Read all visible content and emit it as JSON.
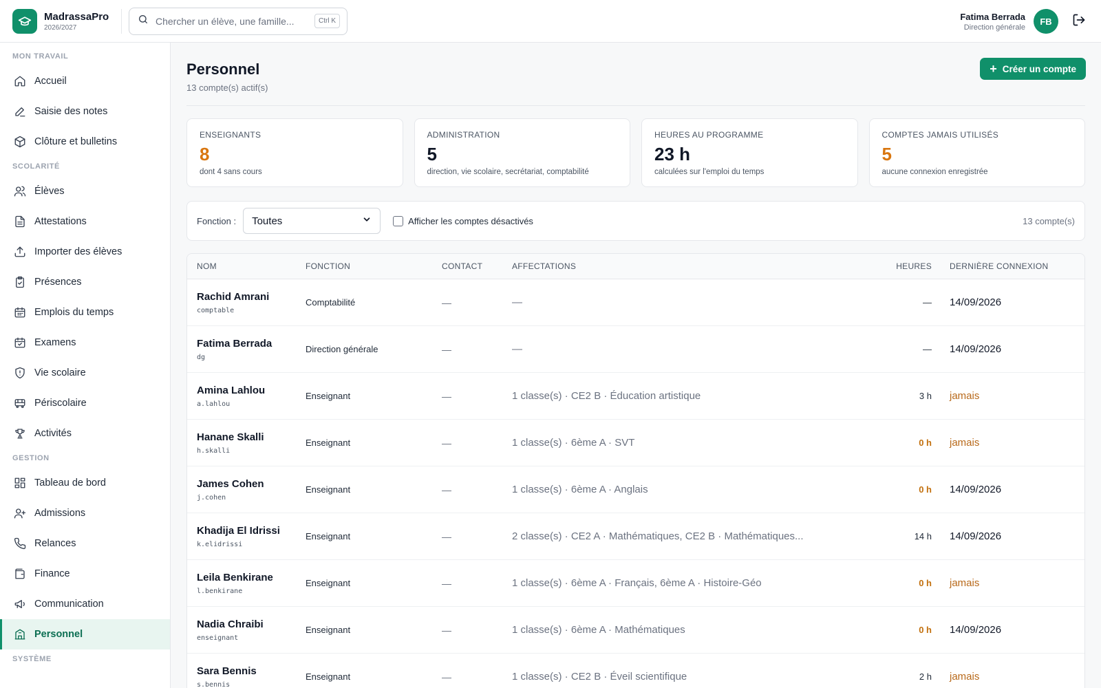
{
  "app": {
    "name": "MadrassaPro",
    "year": "2026/2027"
  },
  "search": {
    "placeholder": "Chercher un élève, une famille...",
    "shortcut": "Ctrl K"
  },
  "user": {
    "name": "Fatima Berrada",
    "role": "Direction générale",
    "initials": "FB"
  },
  "sidebar": {
    "sections": [
      {
        "title": "MON TRAVAIL",
        "items": [
          {
            "label": "Accueil",
            "icon": "home-icon"
          },
          {
            "label": "Saisie des notes",
            "icon": "pencil-icon"
          },
          {
            "label": "Clôture et bulletins",
            "icon": "package-icon"
          }
        ]
      },
      {
        "title": "SCOLARITÉ",
        "items": [
          {
            "label": "Élèves",
            "icon": "users-icon"
          },
          {
            "label": "Attestations",
            "icon": "file-text-icon"
          },
          {
            "label": "Importer des élèves",
            "icon": "upload-icon"
          },
          {
            "label": "Présences",
            "icon": "clipboard-check-icon"
          },
          {
            "label": "Emplois du temps",
            "icon": "calendar-icon"
          },
          {
            "label": "Examens",
            "icon": "calendar-check-icon"
          },
          {
            "label": "Vie scolaire",
            "icon": "shield-icon"
          },
          {
            "label": "Périscolaire",
            "icon": "bus-icon"
          },
          {
            "label": "Activités",
            "icon": "trophy-icon"
          }
        ]
      },
      {
        "title": "GESTION",
        "items": [
          {
            "label": "Tableau de bord",
            "icon": "dashboard-icon"
          },
          {
            "label": "Admissions",
            "icon": "user-plus-icon"
          },
          {
            "label": "Relances",
            "icon": "phone-icon"
          },
          {
            "label": "Finance",
            "icon": "wallet-icon"
          },
          {
            "label": "Communication",
            "icon": "megaphone-icon"
          },
          {
            "label": "Personnel",
            "icon": "building-icon",
            "active": true
          }
        ]
      },
      {
        "title": "SYSTÈME",
        "items": []
      }
    ]
  },
  "page": {
    "title": "Personnel",
    "subtitle": "13 compte(s) actif(s)",
    "create_label": "Créer un compte"
  },
  "stats": [
    {
      "label": "ENSEIGNANTS",
      "value": "8",
      "desc": "dont 4 sans cours",
      "color": "#d9760f"
    },
    {
      "label": "ADMINISTRATION",
      "value": "5",
      "desc": "direction, vie scolaire, secrétariat, comptabilité",
      "color": "#111827"
    },
    {
      "label": "HEURES AU PROGRAMME",
      "value": "23 h",
      "desc": "calculées sur l'emploi du temps",
      "color": "#111827"
    },
    {
      "label": "COMPTES JAMAIS UTILISÉS",
      "value": "5",
      "desc": "aucune connexion enregistrée",
      "color": "#d9760f"
    }
  ],
  "filter": {
    "label": "Fonction :",
    "selected": "Toutes",
    "checkbox_label": "Afficher les comptes désactivés",
    "count": "13 compte(s)"
  },
  "table": {
    "columns": [
      "NOM",
      "FONCTION",
      "CONTACT",
      "AFFECTATIONS",
      "HEURES",
      "DERNIÈRE CONNEXION"
    ],
    "rows": [
      {
        "name": "Rachid Amrani",
        "login": "comptable",
        "fonction": "Comptabilité",
        "contact": "—",
        "affectations": "—",
        "heures": "—",
        "last": "14/09/2026"
      },
      {
        "name": "Fatima Berrada",
        "login": "dg",
        "fonction": "Direction générale",
        "contact": "—",
        "affectations": "—",
        "heures": "—",
        "last": "14/09/2026"
      },
      {
        "name": "Amina Lahlou",
        "login": "a.lahlou",
        "fonction": "Enseignant",
        "contact": "—",
        "affectations": "1 classe(s) · CE2 B · Éducation artistique",
        "heures": "3 h",
        "last": "jamais"
      },
      {
        "name": "Hanane Skalli",
        "login": "h.skalli",
        "fonction": "Enseignant",
        "contact": "—",
        "affectations": "1 classe(s) · 6ème A · SVT",
        "heures": "0 h",
        "last": "jamais"
      },
      {
        "name": "James Cohen",
        "login": "j.cohen",
        "fonction": "Enseignant",
        "contact": "—",
        "affectations": "1 classe(s) · 6ème A · Anglais",
        "heures": "0 h",
        "last": "14/09/2026"
      },
      {
        "name": "Khadija El Idrissi",
        "login": "k.elidrissi",
        "fonction": "Enseignant",
        "contact": "—",
        "affectations": "2 classe(s) · CE2 A · Mathématiques, CE2 B · Mathématiques...",
        "heures": "14 h",
        "last": "14/09/2026"
      },
      {
        "name": "Leila Benkirane",
        "login": "l.benkirane",
        "fonction": "Enseignant",
        "contact": "—",
        "affectations": "1 classe(s) · 6ème A · Français, 6ème A · Histoire-Géo",
        "heures": "0 h",
        "last": "jamais"
      },
      {
        "name": "Nadia Chraibi",
        "login": "enseignant",
        "fonction": "Enseignant",
        "contact": "—",
        "affectations": "1 classe(s) · 6ème A · Mathématiques",
        "heures": "0 h",
        "last": "14/09/2026"
      },
      {
        "name": "Sara Bennis",
        "login": "s.bennis",
        "fonction": "Enseignant",
        "contact": "—",
        "affectations": "1 classe(s) · CE2 B · Éveil scientifique",
        "heures": "2 h",
        "last": "jamais"
      }
    ]
  },
  "colors": {
    "accent": "#10906a",
    "warning": "#d9760f"
  }
}
